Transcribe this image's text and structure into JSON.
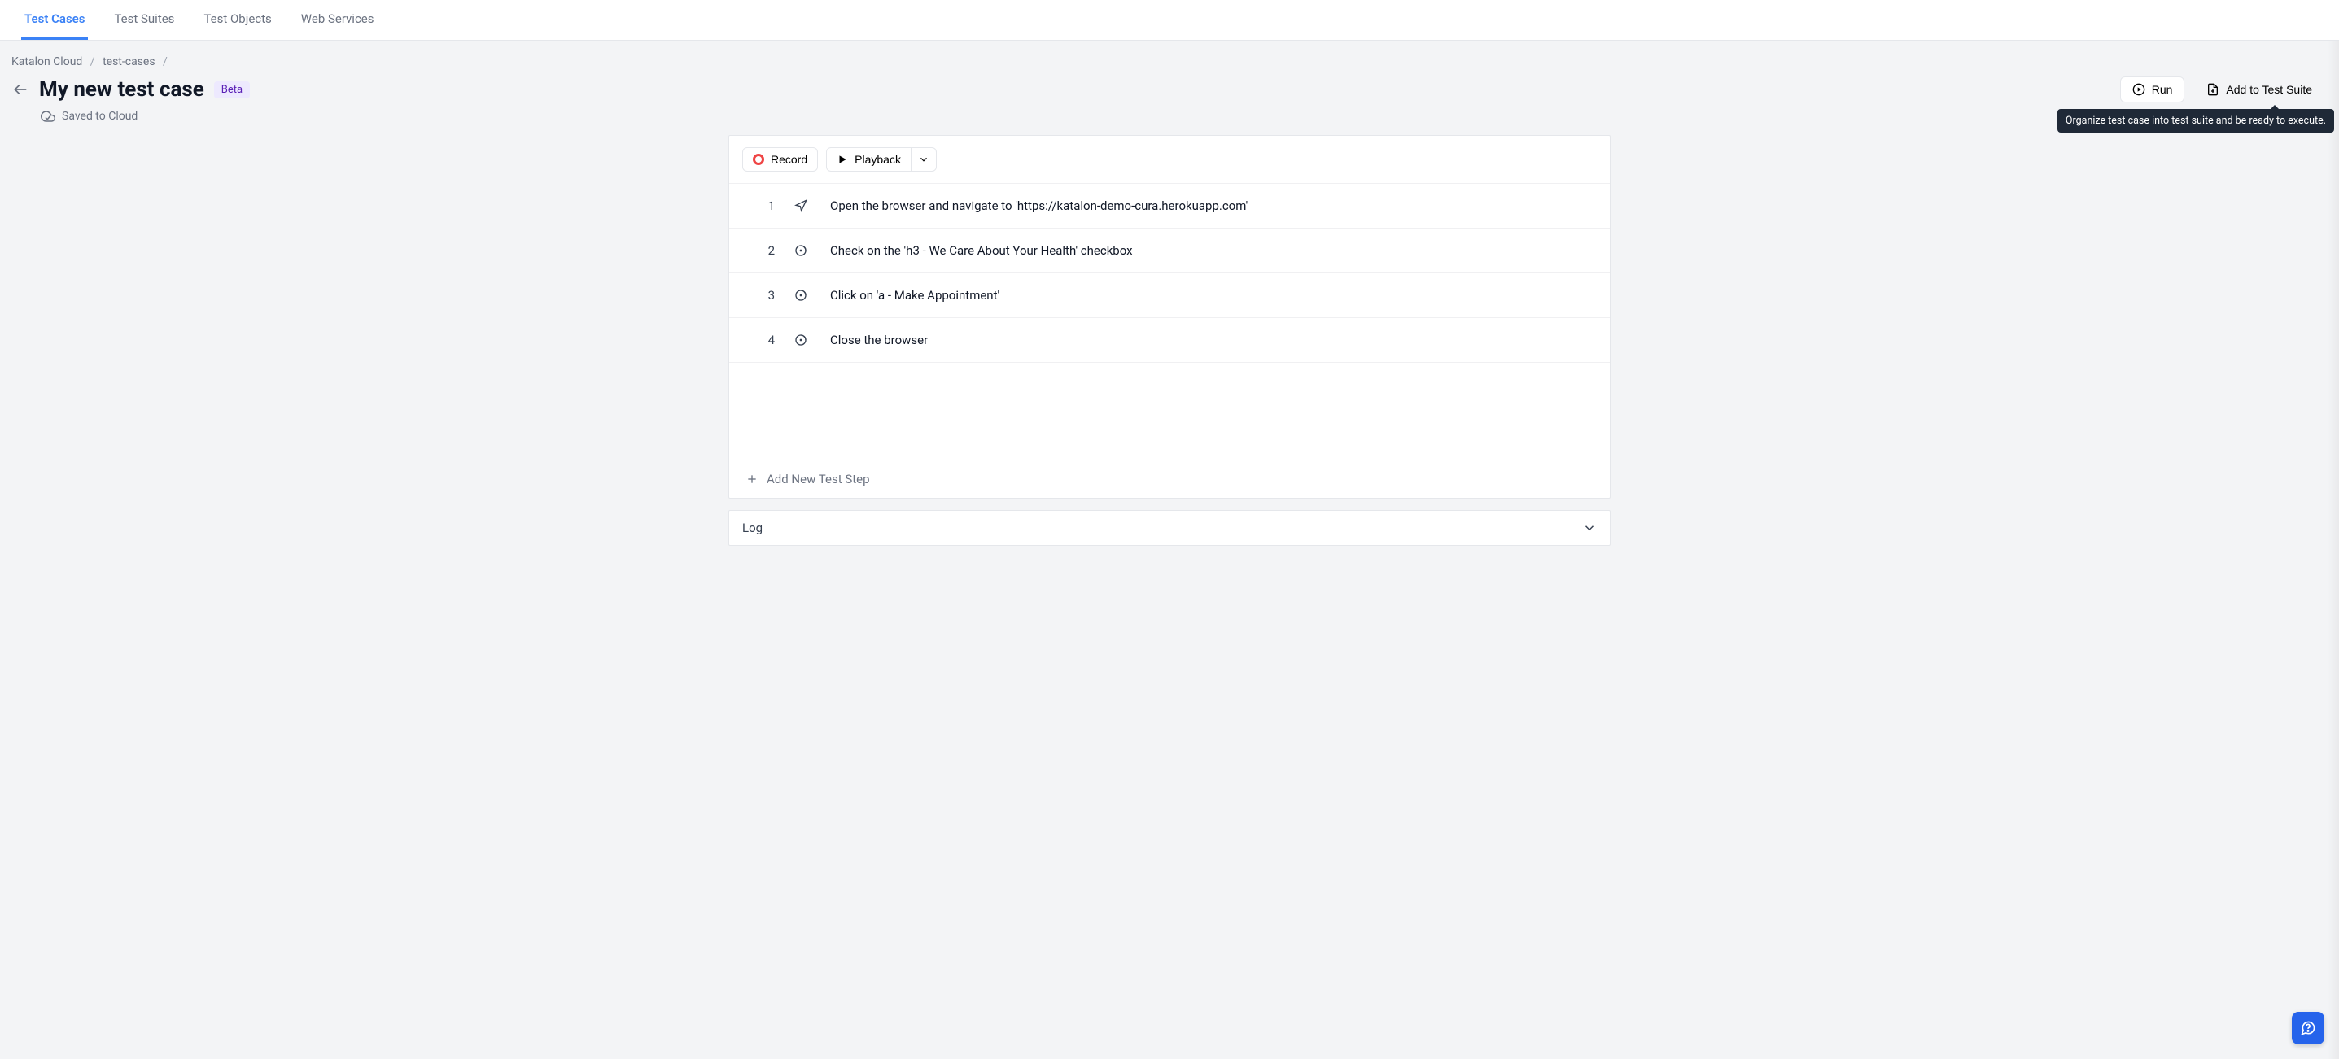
{
  "tabs": {
    "test_cases": "Test Cases",
    "test_suites": "Test Suites",
    "test_objects": "Test Objects",
    "web_services": "Web Services"
  },
  "breadcrumb": {
    "root": "Katalon Cloud",
    "level1": "test-cases"
  },
  "page": {
    "title": "My new test case",
    "beta_label": "Beta",
    "saved_status": "Saved to Cloud"
  },
  "actions": {
    "run_label": "Run",
    "add_to_suite_label": "Add to Test Suite",
    "add_to_suite_tooltip": "Organize test case into test suite and be ready to execute."
  },
  "panel": {
    "record_label": "Record",
    "playback_label": "Playback",
    "add_step_label": "Add New Test Step"
  },
  "steps": [
    {
      "num": "1",
      "kind": "navigate",
      "text": "Open the browser and navigate to 'https://katalon-demo-cura.herokuapp.com'"
    },
    {
      "num": "2",
      "kind": "target",
      "text": "Check on the 'h3 - We Care About Your Health' checkbox"
    },
    {
      "num": "3",
      "kind": "target",
      "text": "Click on 'a - Make Appointment'"
    },
    {
      "num": "4",
      "kind": "target",
      "text": "Close the browser"
    }
  ],
  "log": {
    "title": "Log"
  }
}
